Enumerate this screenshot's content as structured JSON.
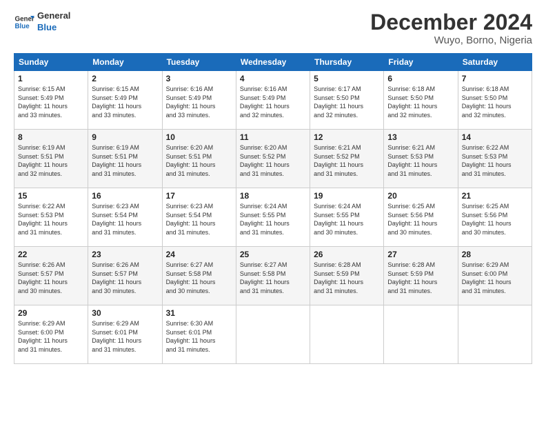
{
  "header": {
    "logo_line1": "General",
    "logo_line2": "Blue",
    "title": "December 2024",
    "location": "Wuyo, Borno, Nigeria"
  },
  "weekdays": [
    "Sunday",
    "Monday",
    "Tuesday",
    "Wednesday",
    "Thursday",
    "Friday",
    "Saturday"
  ],
  "weeks": [
    [
      {
        "day": "1",
        "info": "Sunrise: 6:15 AM\nSunset: 5:49 PM\nDaylight: 11 hours\nand 33 minutes."
      },
      {
        "day": "2",
        "info": "Sunrise: 6:15 AM\nSunset: 5:49 PM\nDaylight: 11 hours\nand 33 minutes."
      },
      {
        "day": "3",
        "info": "Sunrise: 6:16 AM\nSunset: 5:49 PM\nDaylight: 11 hours\nand 33 minutes."
      },
      {
        "day": "4",
        "info": "Sunrise: 6:16 AM\nSunset: 5:49 PM\nDaylight: 11 hours\nand 32 minutes."
      },
      {
        "day": "5",
        "info": "Sunrise: 6:17 AM\nSunset: 5:50 PM\nDaylight: 11 hours\nand 32 minutes."
      },
      {
        "day": "6",
        "info": "Sunrise: 6:18 AM\nSunset: 5:50 PM\nDaylight: 11 hours\nand 32 minutes."
      },
      {
        "day": "7",
        "info": "Sunrise: 6:18 AM\nSunset: 5:50 PM\nDaylight: 11 hours\nand 32 minutes."
      }
    ],
    [
      {
        "day": "8",
        "info": "Sunrise: 6:19 AM\nSunset: 5:51 PM\nDaylight: 11 hours\nand 32 minutes."
      },
      {
        "day": "9",
        "info": "Sunrise: 6:19 AM\nSunset: 5:51 PM\nDaylight: 11 hours\nand 31 minutes."
      },
      {
        "day": "10",
        "info": "Sunrise: 6:20 AM\nSunset: 5:51 PM\nDaylight: 11 hours\nand 31 minutes."
      },
      {
        "day": "11",
        "info": "Sunrise: 6:20 AM\nSunset: 5:52 PM\nDaylight: 11 hours\nand 31 minutes."
      },
      {
        "day": "12",
        "info": "Sunrise: 6:21 AM\nSunset: 5:52 PM\nDaylight: 11 hours\nand 31 minutes."
      },
      {
        "day": "13",
        "info": "Sunrise: 6:21 AM\nSunset: 5:53 PM\nDaylight: 11 hours\nand 31 minutes."
      },
      {
        "day": "14",
        "info": "Sunrise: 6:22 AM\nSunset: 5:53 PM\nDaylight: 11 hours\nand 31 minutes."
      }
    ],
    [
      {
        "day": "15",
        "info": "Sunrise: 6:22 AM\nSunset: 5:53 PM\nDaylight: 11 hours\nand 31 minutes."
      },
      {
        "day": "16",
        "info": "Sunrise: 6:23 AM\nSunset: 5:54 PM\nDaylight: 11 hours\nand 31 minutes."
      },
      {
        "day": "17",
        "info": "Sunrise: 6:23 AM\nSunset: 5:54 PM\nDaylight: 11 hours\nand 31 minutes."
      },
      {
        "day": "18",
        "info": "Sunrise: 6:24 AM\nSunset: 5:55 PM\nDaylight: 11 hours\nand 31 minutes."
      },
      {
        "day": "19",
        "info": "Sunrise: 6:24 AM\nSunset: 5:55 PM\nDaylight: 11 hours\nand 30 minutes."
      },
      {
        "day": "20",
        "info": "Sunrise: 6:25 AM\nSunset: 5:56 PM\nDaylight: 11 hours\nand 30 minutes."
      },
      {
        "day": "21",
        "info": "Sunrise: 6:25 AM\nSunset: 5:56 PM\nDaylight: 11 hours\nand 30 minutes."
      }
    ],
    [
      {
        "day": "22",
        "info": "Sunrise: 6:26 AM\nSunset: 5:57 PM\nDaylight: 11 hours\nand 30 minutes."
      },
      {
        "day": "23",
        "info": "Sunrise: 6:26 AM\nSunset: 5:57 PM\nDaylight: 11 hours\nand 30 minutes."
      },
      {
        "day": "24",
        "info": "Sunrise: 6:27 AM\nSunset: 5:58 PM\nDaylight: 11 hours\nand 30 minutes."
      },
      {
        "day": "25",
        "info": "Sunrise: 6:27 AM\nSunset: 5:58 PM\nDaylight: 11 hours\nand 31 minutes."
      },
      {
        "day": "26",
        "info": "Sunrise: 6:28 AM\nSunset: 5:59 PM\nDaylight: 11 hours\nand 31 minutes."
      },
      {
        "day": "27",
        "info": "Sunrise: 6:28 AM\nSunset: 5:59 PM\nDaylight: 11 hours\nand 31 minutes."
      },
      {
        "day": "28",
        "info": "Sunrise: 6:29 AM\nSunset: 6:00 PM\nDaylight: 11 hours\nand 31 minutes."
      }
    ],
    [
      {
        "day": "29",
        "info": "Sunrise: 6:29 AM\nSunset: 6:00 PM\nDaylight: 11 hours\nand 31 minutes."
      },
      {
        "day": "30",
        "info": "Sunrise: 6:29 AM\nSunset: 6:01 PM\nDaylight: 11 hours\nand 31 minutes."
      },
      {
        "day": "31",
        "info": "Sunrise: 6:30 AM\nSunset: 6:01 PM\nDaylight: 11 hours\nand 31 minutes."
      },
      null,
      null,
      null,
      null
    ]
  ]
}
